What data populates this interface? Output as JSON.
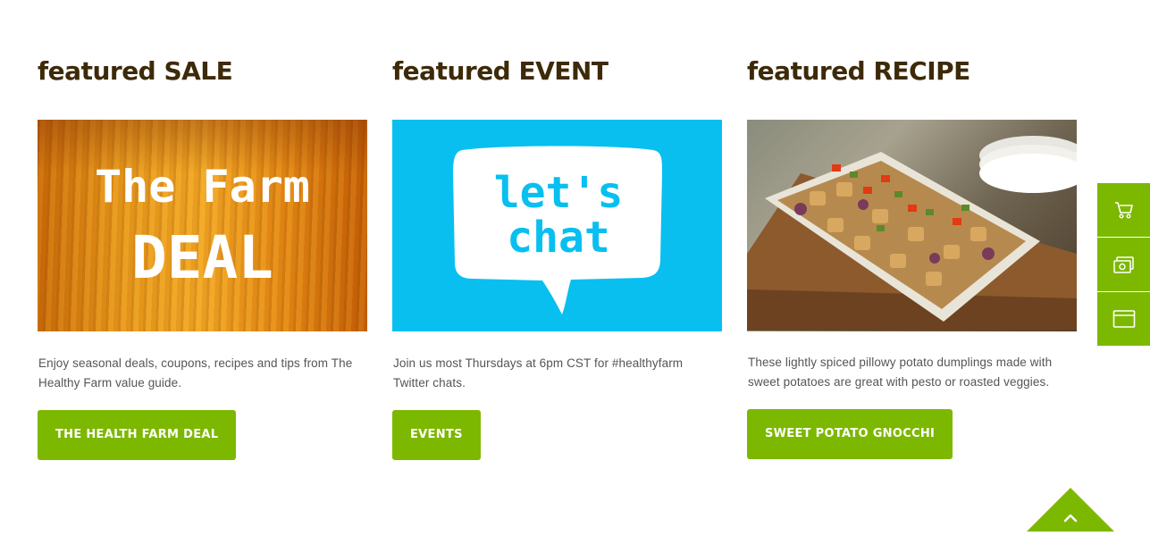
{
  "features": [
    {
      "heading": "featured SALE",
      "image_text_line1": "The Farm",
      "image_text_line2": "DEAL",
      "description": "Enjoy seasonal deals, coupons, recipes and tips from The Healthy Farm value guide.",
      "button_label": "THE HEALTH FARM DEAL"
    },
    {
      "heading": "featured EVENT",
      "image_text_line1": "let's",
      "image_text_line2": "chat",
      "description": "Join us most Thursdays at 6pm CST for #healthyfarm Twitter chats.",
      "button_label": "EVENTS"
    },
    {
      "heading": "featured RECIPE",
      "description": "These lightly spiced pillowy potato dumplings made with sweet potatoes are great with pesto or roasted veggies.",
      "button_label": "SWEET POTATO GNOCCHI"
    }
  ],
  "sidebar": {
    "icons": [
      "cart-icon",
      "coupon-icon",
      "browser-window-icon"
    ]
  },
  "back_to_top": {
    "icon": "chevron-up-icon"
  },
  "colors": {
    "accent_green": "#7db800",
    "heading_brown": "#3d2a08",
    "event_blue": "#08bff0",
    "body_text": "#555555"
  }
}
